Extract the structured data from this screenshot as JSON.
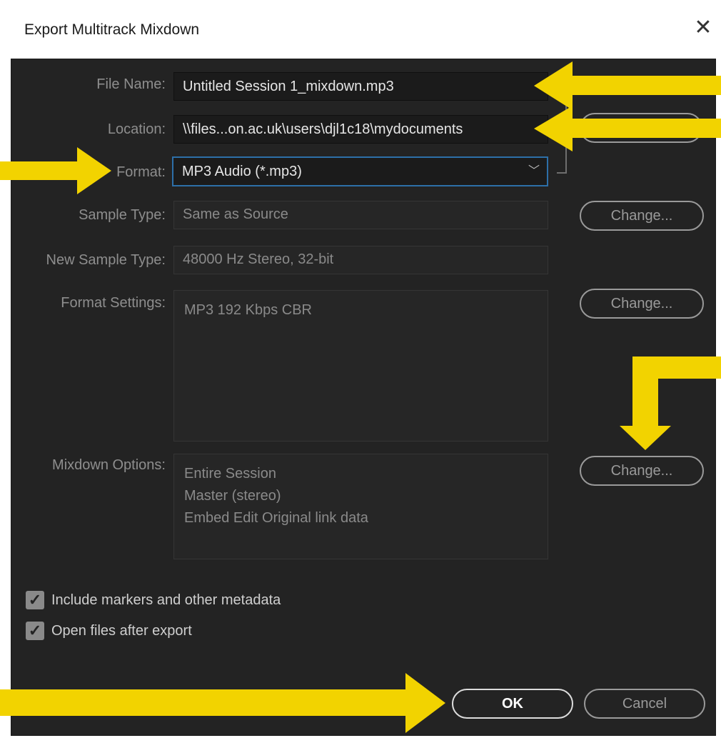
{
  "window": {
    "title": "Export Multitrack Mixdown",
    "close_glyph": "✕",
    "close_icon": "close-icon"
  },
  "fields": {
    "file_name_label": "File Name:",
    "file_name_value": "Untitled Session 1_mixdown.mp3",
    "location_label": "Location:",
    "location_value": "\\\\files...on.ac.uk\\users\\djl1c18\\mydocuments",
    "format_label": "Format:",
    "format_value": "MP3 Audio (*.mp3)",
    "format_chevron": "﹀",
    "sample_type_label": "Sample Type:",
    "sample_type_value": "Same as Source",
    "new_sample_type_label": "New Sample Type:",
    "new_sample_type_value": "48000 Hz Stereo, 32-bit",
    "format_settings_label": "Format Settings:",
    "format_settings_value": "MP3 192 Kbps CBR",
    "mixdown_options_label": "Mixdown Options:",
    "mixdown_options_lines": [
      "Entire Session",
      "Master (stereo)",
      "Embed Edit Original link data"
    ]
  },
  "buttons": {
    "change": "Change...",
    "ok": "OK",
    "cancel": "Cancel"
  },
  "checkboxes": [
    {
      "label": "Include markers and other metadata",
      "checked": true
    },
    {
      "label": "Open files after export",
      "checked": true
    }
  ],
  "checkmark_glyph": "✓",
  "colors": {
    "annotation_arrow": "#F2D300",
    "focus_border": "#2D6FA8",
    "dialog_bg": "#232323"
  }
}
